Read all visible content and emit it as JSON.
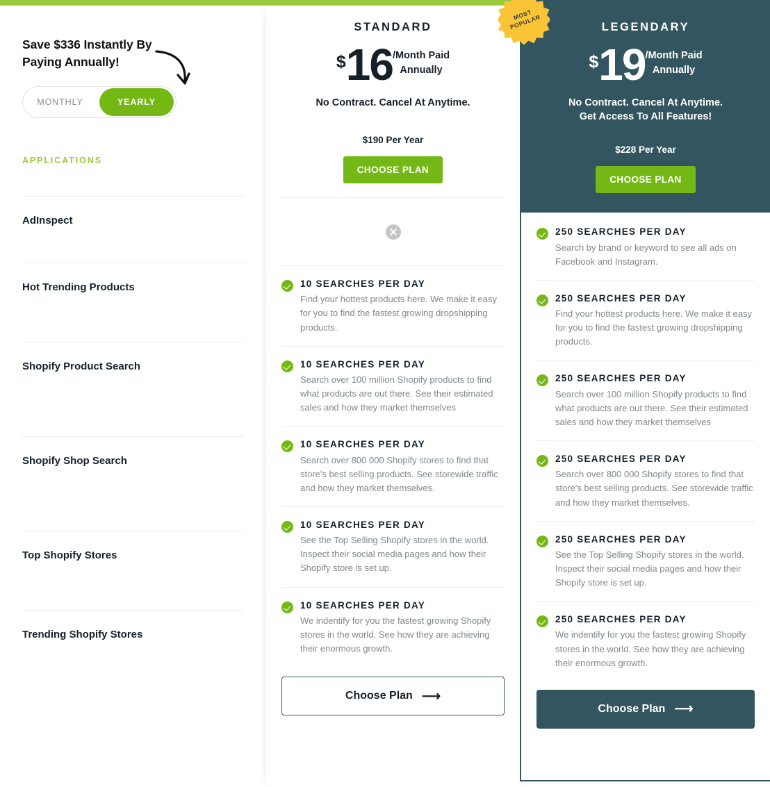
{
  "theme": {
    "accent_green": "#9aca3c",
    "button_green": "#74b816",
    "dark_teal": "#33555f",
    "badge_yellow": "#f9c536",
    "muted_text": "#80878b"
  },
  "sidebar": {
    "save_heading": "Save $336 Instantly By Paying Annually!",
    "toggle": {
      "monthly_label": "MONTHLY",
      "yearly_label": "YEARLY",
      "selected": "YEARLY"
    },
    "section_label": "APPLICATIONS",
    "items": [
      {
        "label": "AdInspect"
      },
      {
        "label": "Hot Trending Products"
      },
      {
        "label": "Shopify Product Search"
      },
      {
        "label": "Shopify Shop Search"
      },
      {
        "label": "Top Shopify Stores"
      },
      {
        "label": "Trending Shopify Stores"
      }
    ]
  },
  "plans": {
    "standard": {
      "name": "STANDARD",
      "currency": "$",
      "amount": "16",
      "per_line1": "/Month Paid",
      "per_line2": "Annually",
      "no_contract_line1": "No Contract. Cancel At Anytime.",
      "no_contract_line2": "",
      "per_year": "$190 Per Year",
      "top_button": "CHOOSE PLAN",
      "bottom_button": "Choose Plan",
      "features": [
        {
          "available": false,
          "title": "",
          "desc": ""
        },
        {
          "available": true,
          "title": "10 SEARCHES PER DAY",
          "desc": "Find your hottest products here. We make it easy for you to find the fastest growing dropshipping products."
        },
        {
          "available": true,
          "title": "10 SEARCHES PER DAY",
          "desc": "Search over 100 million Shopify products to find what products are out there. See their estimated sales and how they market themselves"
        },
        {
          "available": true,
          "title": "10 SEARCHES PER DAY",
          "desc": "Search over 800 000 Shopify stores to find that store's best selling products. See storewide traffic and how they market themselves."
        },
        {
          "available": true,
          "title": "10 SEARCHES PER DAY",
          "desc": "See the Top Selling Shopify stores in the world. Inspect their social media pages and how their Shopify store is set up."
        },
        {
          "available": true,
          "title": "10 SEARCHES PER DAY",
          "desc": "We indentify for you the fastest growing Shopify stores in the world. See how they are achieving their enormous growth."
        }
      ]
    },
    "legendary": {
      "name": "LEGENDARY",
      "badge_line1": "MOST",
      "badge_line2": "POPULAR",
      "currency": "$",
      "amount": "19",
      "per_line1": "/Month Paid",
      "per_line2": "Annually",
      "no_contract_line1": "No Contract. Cancel At Anytime.",
      "no_contract_line2": "Get Access To All Features!",
      "per_year": "$228 Per Year",
      "top_button": "CHOOSE PLAN",
      "bottom_button": "Choose Plan",
      "features": [
        {
          "available": true,
          "title": "250 SEARCHES PER DAY",
          "desc": "Search by brand or keyword to see all ads on Facebook and Instagram."
        },
        {
          "available": true,
          "title": "250 SEARCHES PER DAY",
          "desc": "Find your hottest products here. We make it easy for you to find the fastest growing dropshipping products."
        },
        {
          "available": true,
          "title": "250 SEARCHES PER DAY",
          "desc": "Search over 100 million Shopify products to find what products are out there. See their estimated sales and how they market themselves"
        },
        {
          "available": true,
          "title": "250 SEARCHES PER DAY",
          "desc": "Search over 800 000 Shopify stores to find that store's best selling products. See storewide traffic and how they market themselves."
        },
        {
          "available": true,
          "title": "250 SEARCHES PER DAY",
          "desc": "See the Top Selling Shopify stores in the world. Inspect their social media pages and how their Shopify store is set up."
        },
        {
          "available": true,
          "title": "250 SEARCHES PER DAY",
          "desc": "We indentify for you the fastest growing Shopify stores in the world. See how they are achieving their enormous growth."
        }
      ]
    }
  },
  "icons": {
    "check": "check-circle-icon",
    "cross": "cross-circle-icon",
    "arrow_right": "⟶"
  }
}
